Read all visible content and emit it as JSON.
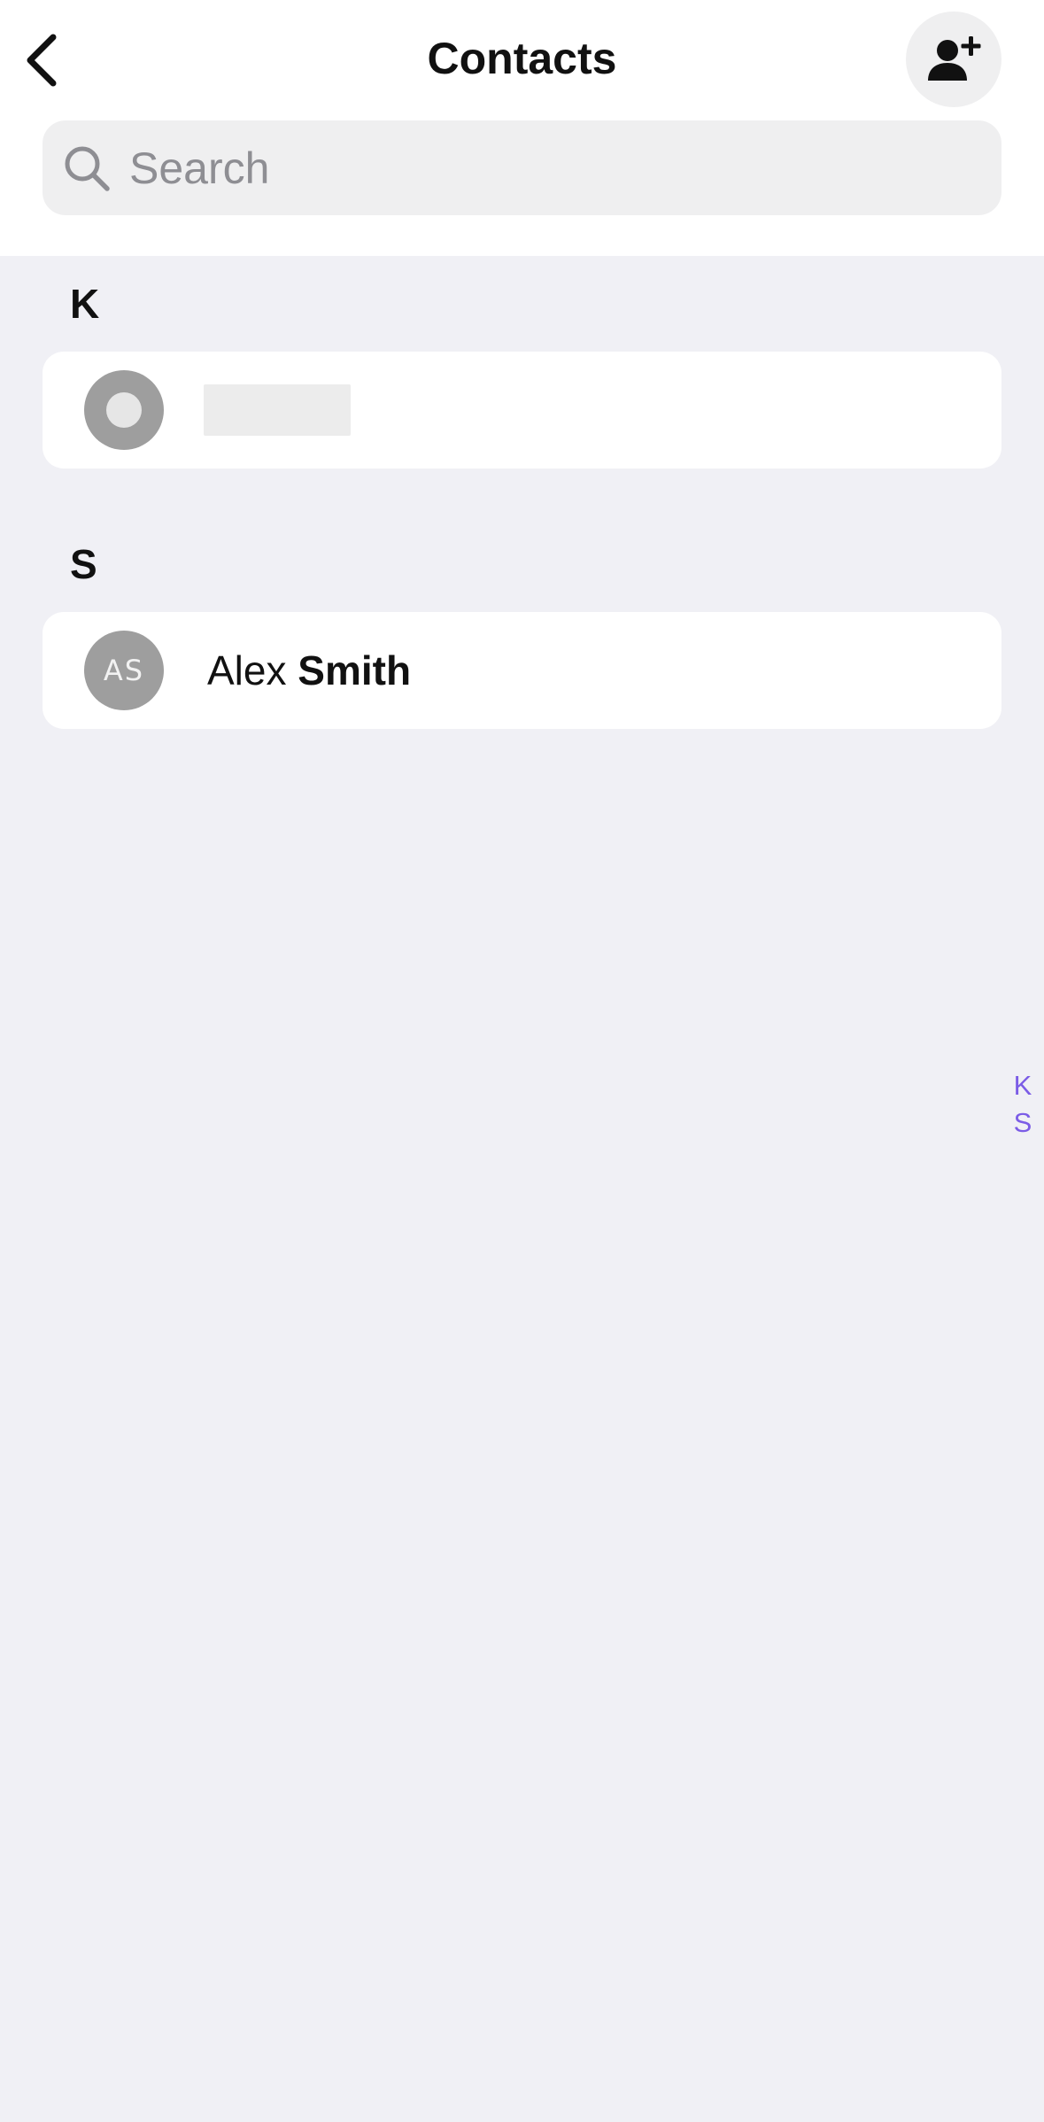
{
  "header": {
    "title": "Contacts",
    "back_icon": "chevron-left-icon",
    "add_contact_icon": "person-add-icon"
  },
  "search": {
    "placeholder": "Search",
    "value": "",
    "icon": "search-icon"
  },
  "sections": [
    {
      "letter": "K",
      "contacts": [
        {
          "first_name": "",
          "last_name": "",
          "initials": "",
          "loading": true
        }
      ]
    },
    {
      "letter": "S",
      "contacts": [
        {
          "first_name": "Alex",
          "last_name": "Smith",
          "initials": "AS",
          "loading": false
        }
      ]
    }
  ],
  "index_bar": [
    "K",
    "S"
  ],
  "colors": {
    "accent": "#7b5ce6",
    "background": "#f0f0f5",
    "avatar": "#9e9e9e"
  }
}
